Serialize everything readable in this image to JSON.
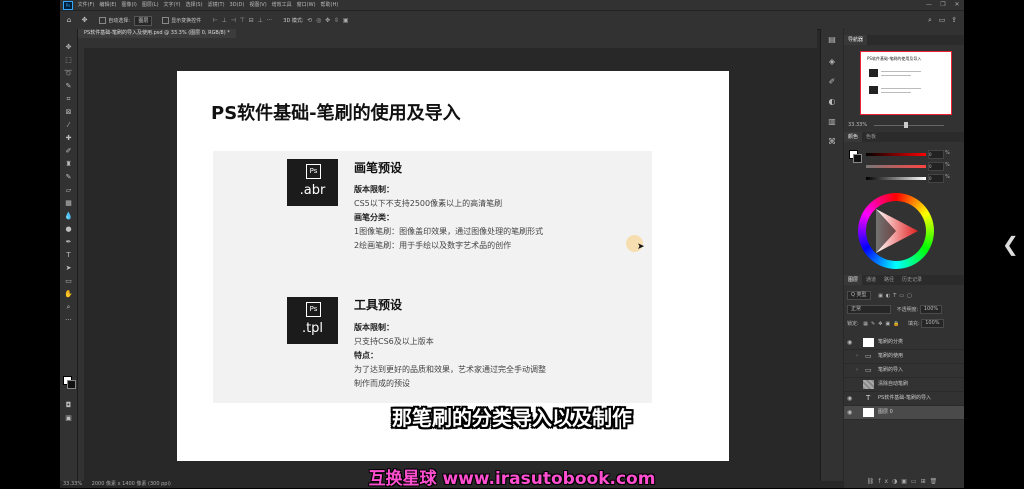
{
  "app": {
    "menu": [
      "文件(F)",
      "编辑(E)",
      "图像(I)",
      "图层(L)",
      "文字(Y)",
      "选择(S)",
      "滤镜(T)",
      "3D(D)",
      "视图(V)",
      "增效工具",
      "窗口(W)",
      "帮助(H)"
    ]
  },
  "options": {
    "auto_select_label": "自动选择:",
    "auto_select_value": "图层",
    "show_transform_label": "显示变换控件",
    "mode_3d_label": "3D 模式:"
  },
  "document": {
    "tab_title": "PS软件基础-笔刷的导入及使用.psd @ 33.3% (图层 0, RGB/8) *"
  },
  "status": {
    "zoom": "33.33%",
    "info": "2000 像素 x 1400 像素 (300 ppi)"
  },
  "slide": {
    "title": "PS软件基础-笔刷的使用及导入",
    "sections": [
      {
        "ext": ".abr",
        "ps": "Ps",
        "heading": "画笔预设",
        "lines": [
          {
            "text": "版本限制：",
            "bold": true
          },
          {
            "text": "CS5以下不支持2500像素以上的高清笔刷",
            "bold": false
          },
          {
            "text": "画笔分类：",
            "bold": true
          },
          {
            "text": "1图像笔刷：图像盖印效果，通过图像处理的笔刷形式",
            "bold": false
          },
          {
            "text": "2绘画笔刷：用于手绘以及数字艺术品的创作",
            "bold": false
          }
        ]
      },
      {
        "ext": ".tpl",
        "ps": "Ps",
        "heading": "工具预设",
        "lines": [
          {
            "text": "版本限制：",
            "bold": true
          },
          {
            "text": "只支持CS6及以上版本",
            "bold": false
          },
          {
            "text": "特点：",
            "bold": true
          },
          {
            "text": "为了达到更好的品质和效果，艺术家通过完全手动调整",
            "bold": false
          },
          {
            "text": "制作而成的预设",
            "bold": false
          }
        ]
      }
    ]
  },
  "overlay": {
    "subtitle": "那笔刷的分类导入以及制作",
    "watermark": "互换星球 www.irasutobook.com"
  },
  "navigator": {
    "tab": "导航器",
    "zoom": "33.33%",
    "thumb_title": "PS软件基础-笔刷的使用及导入"
  },
  "color": {
    "tabs": [
      "颜色",
      "色板"
    ],
    "values": [
      "0",
      "0",
      "0"
    ],
    "unit": "%"
  },
  "layers": {
    "tabs": [
      "图层",
      "通道",
      "路径",
      "历史记录"
    ],
    "kind_filter": "Q 类型",
    "blend_mode": "正常",
    "opacity_label": "不透明度:",
    "opacity": "100%",
    "lock_label": "锁定:",
    "fill_label": "填充:",
    "fill": "100%",
    "items": [
      {
        "name": "笔刷的分类",
        "type": "text"
      },
      {
        "name": "笔刷的使用",
        "type": "folder"
      },
      {
        "name": "笔刷的导入",
        "type": "folder"
      },
      {
        "name": "清除自动笔刷",
        "type": "pattern"
      },
      {
        "name": "PS软件基础-笔刷的导入",
        "type": "type"
      },
      {
        "name": "图层 0",
        "type": "white"
      }
    ]
  },
  "colors": {
    "ps_bg": "#282828",
    "panel": "#323232",
    "subtitle_text": "#ffffff",
    "watermark_text": "#ff4fd0"
  }
}
